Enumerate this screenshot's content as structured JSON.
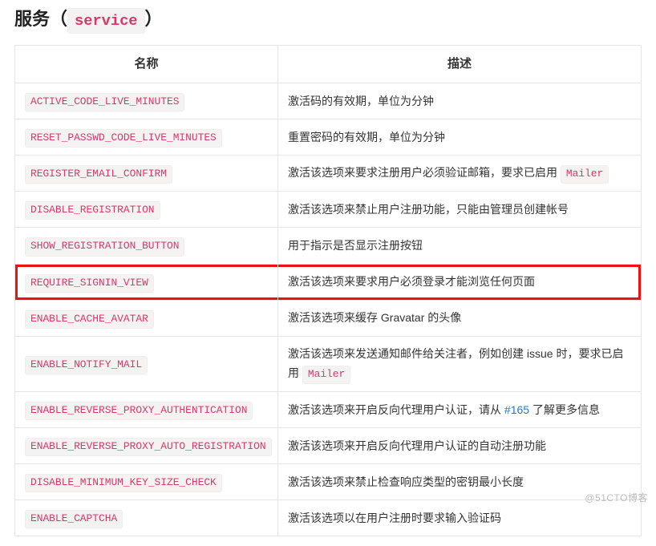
{
  "title_prefix": "服务（",
  "title_code": "service",
  "title_suffix": "）",
  "headers": {
    "name": "名称",
    "desc": "描述"
  },
  "rows": [
    {
      "name": "ACTIVE_CODE_LIVE_MINUTES",
      "desc": "激活码的有效期，单位为分钟"
    },
    {
      "name": "RESET_PASSWD_CODE_LIVE_MINUTES",
      "desc": "重置密码的有效期，单位为分钟"
    },
    {
      "name": "REGISTER_EMAIL_CONFIRM",
      "desc_pre": "激活该选项来要求注册用户必须验证邮箱，要求已启用 ",
      "code": "Mailer"
    },
    {
      "name": "DISABLE_REGISTRATION",
      "desc": "激活该选项来禁止用户注册功能，只能由管理员创建帐号"
    },
    {
      "name": "SHOW_REGISTRATION_BUTTON",
      "desc": "用于指示是否显示注册按钮"
    },
    {
      "name": "REQUIRE_SIGNIN_VIEW",
      "desc": "激活该选项来要求用户必须登录才能浏览任何页面",
      "highlight": true
    },
    {
      "name": "ENABLE_CACHE_AVATAR",
      "desc": "激活该选项来缓存 Gravatar 的头像"
    },
    {
      "name": "ENABLE_NOTIFY_MAIL",
      "desc_pre": "激活该选项来发送通知邮件给关注者，例如创建 issue 时，要求已启用 ",
      "code": "Mailer"
    },
    {
      "name": "ENABLE_REVERSE_PROXY_AUTHENTICATION",
      "desc_pre": "激活该选项来开启反向代理用户认证，请从 ",
      "link_text": "#165",
      "desc_post": " 了解更多信息"
    },
    {
      "name": "ENABLE_REVERSE_PROXY_AUTO_REGISTRATION",
      "desc": "激活该选项来开启反向代理用户认证的自动注册功能"
    },
    {
      "name": "DISABLE_MINIMUM_KEY_SIZE_CHECK",
      "desc": "激活该选项来禁止检查响应类型的密钥最小长度"
    },
    {
      "name": "ENABLE_CAPTCHA",
      "desc": "激活该选项以在用户注册时要求输入验证码"
    }
  ],
  "watermark": "@51CTO博客"
}
